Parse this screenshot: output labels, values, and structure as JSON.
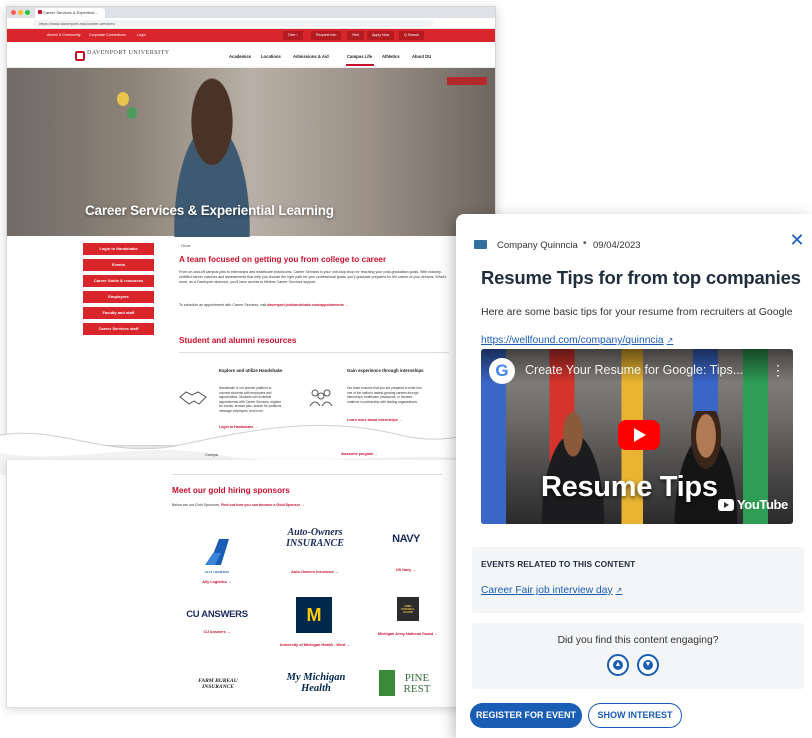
{
  "browser": {
    "tab_title": "Career Services & Experienti...",
    "url": "https://www.davenport.edu/career-services"
  },
  "site": {
    "util_links": [
      "Alumni & Community",
      "Corporate Connections",
      "Login"
    ],
    "util_buttons": [
      "Give ›",
      "Request Info",
      "Visit",
      "Apply Now",
      "Q Search"
    ],
    "logo": "DAVENPORT UNIVERSITY",
    "nav": [
      "Academics",
      "Locations",
      "Admissions & Aid",
      "Campus Life",
      "Athletics",
      "About DU"
    ],
    "hero_title": "Career Services & Experiential Learning",
    "sidebar": [
      "Login to Handshake",
      "Events",
      "Career Guide & resources",
      "Employers",
      "Faculty and staff",
      "Career Services staff"
    ],
    "breadcrumb": "Home",
    "team_heading": "A team focused on getting you from college to career",
    "team_body": "From on-and-off campus jobs to internships and healthcare practicums, Career Services is your one-stop shop for reaching your post-graduation goals. With industry-certified career coaches and assessments that help you choose the right path for your professional goals, you'll graduate prepared for the career of your dreams. What's more, as a Davenport alumnus, you'll have access to lifetime Career Services support.",
    "schedule_text": "To schedule an appointment with Career Services, visit",
    "schedule_link": "davenport.joinhandshake.com/appointments →",
    "resources_heading": "Student and alumni resources",
    "card1": {
      "title": "Explore and utilize Handshake",
      "body": "Handshake is our premier platform to connect students with employers and opportunities. Students can schedule appointments with Career Services, register for events, browse jobs, search for positions, message employers, and more.",
      "link": "Login to Handshake →"
    },
    "card2": {
      "title": "Gain experience through internships",
      "body": "Our team ensures that you are prepared to enter into one of the nation's fastest growing careers through internships, healthcare practicums, or focused rotations in partnership with leading organizations.",
      "link": "Learn more about internships →"
    },
    "hidden_fragment": "Compa",
    "hidden_link": "Awesome program →",
    "sponsors_heading": "Meet our gold hiring sponsors",
    "sponsors_sub": "Below are our Gold Sponsors.",
    "sponsors_link": "Find out how you can become a Gold Sponsor →",
    "sponsors": [
      {
        "logo": "ALLY LOGISTICS",
        "caption": "Ally Logistics →"
      },
      {
        "logo": "Auto-Owners INSURANCE",
        "caption": "Auto-Owners Insurance →"
      },
      {
        "logo": "NAVY",
        "caption": "US Navy →"
      },
      {
        "logo": "CU ANSWERS",
        "caption": "CU Answers →"
      },
      {
        "logo": "M",
        "caption": "University of Michigan Health - West →"
      },
      {
        "logo": "ARMY NATIONAL GUARD",
        "caption": "Michigan Army National Guard →"
      },
      {
        "logo": "FARM BUREAU INSURANCE",
        "caption": ""
      },
      {
        "logo": "My Michigan Health",
        "caption": ""
      },
      {
        "logo": "PINE REST",
        "caption": ""
      }
    ]
  },
  "card": {
    "source": "Company Quinncia",
    "separator": "•",
    "date": "09/04/2023",
    "close": "✕",
    "title": "Resume Tips for from top companies",
    "description": "Here are some basic tips for your resume from recruiters at Google",
    "url": "https://wellfound.com/company/quinncia",
    "video": {
      "channel_letter": "G",
      "title": "Create Your Resume for Google: Tips...",
      "caption": "Resume Tips",
      "platform": "YouTube"
    },
    "events_heading": "EVENTS RELATED TO THIS CONTENT",
    "event_link": "Career Fair job interview day",
    "engage_question": "Did you find this content engaging?",
    "register_button": "REGISTER FOR EVENT",
    "interest_button": "SHOW INTEREST"
  },
  "colors": {
    "du_red": "#d9262c",
    "link_blue": "#1a5db4",
    "title_navy": "#1f2d3d"
  }
}
